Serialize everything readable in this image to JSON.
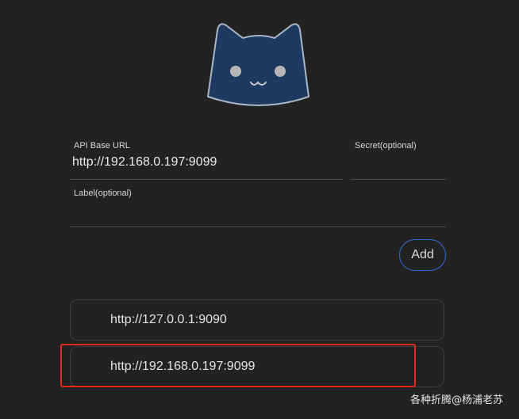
{
  "form": {
    "api_base_url": {
      "label": "API Base URL",
      "value": "http://192.168.0.197:9099"
    },
    "secret": {
      "label": "Secret(optional)",
      "value": ""
    },
    "label_field": {
      "label": "Label(optional)",
      "value": ""
    },
    "add_button": "Add"
  },
  "backends": [
    {
      "url": "http://127.0.0.1:9090"
    },
    {
      "url": "http://192.168.0.197:9099"
    }
  ],
  "logo": {
    "icon": "cat-face-icon",
    "fill": "#1f3a60",
    "stroke": "#a9b7c8",
    "eyes": "#b7b7b7"
  },
  "highlight": {
    "color": "#e02a1f"
  },
  "watermark": "各种折腾@杨浦老苏"
}
